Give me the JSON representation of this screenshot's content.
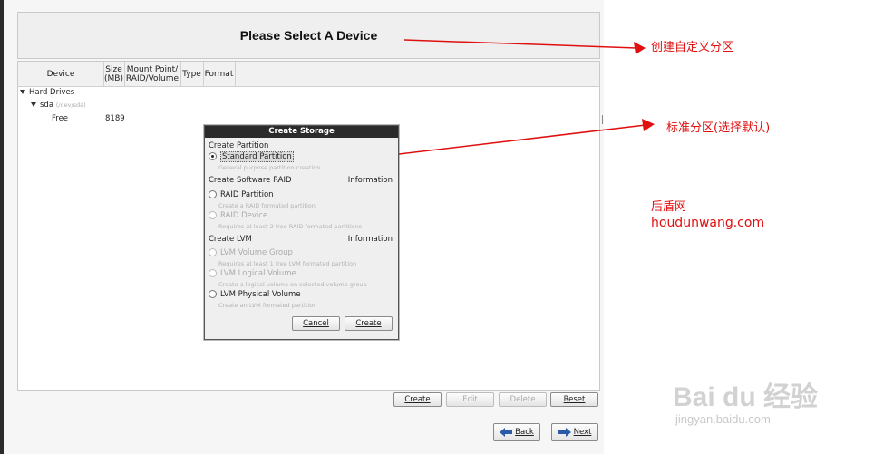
{
  "header": {
    "title": "Please Select A Device"
  },
  "table": {
    "columns": [
      "Device",
      "Size\n(MB)",
      "Mount Point/\nRAID/Volume",
      "Type",
      "Format"
    ],
    "tree": {
      "group": "Hard Drives",
      "disk_name": "sda",
      "disk_path": "(/dev/sda)",
      "free_label": "Free",
      "free_size": "8189"
    }
  },
  "dialog": {
    "title": "Create Storage",
    "partition_section": "Create Partition",
    "standard_partition": "Standard Partition",
    "standard_partition_desc": "General purpose partition creation",
    "raid_section": "Create Software RAID",
    "raid_info": "Information",
    "raid_partition": "RAID Partition",
    "raid_partition_desc": "Create a RAID formated partition",
    "raid_device": "RAID Device",
    "raid_device_desc": "Requires at least 2 free RAID formated partitions",
    "lvm_section": "Create LVM",
    "lvm_info": "Information",
    "lvm_volume_group": "LVM Volume Group",
    "lvm_volume_group_desc": "Requires at least 1 free LVM formated partition",
    "lvm_logical_volume": "LVM Logical Volume",
    "lvm_logical_volume_desc": "Create a logical volume on selected volume group",
    "lvm_physical_volume": "LVM Physical Volume",
    "lvm_physical_volume_desc": "Create an LVM formated partition",
    "cancel": "Cancel",
    "create": "Create"
  },
  "toolbar": {
    "create": "Create",
    "edit": "Edit",
    "delete": "Delete",
    "reset": "Reset"
  },
  "nav": {
    "back": "Back",
    "next": "Next"
  },
  "annotations": {
    "custom_partition": "创建自定义分区",
    "standard_partition_note": "标准分区(选择默认)",
    "site_name": "后盾网",
    "site_url": "houdunwang.com"
  },
  "watermark": {
    "logo": "Bai du 经验",
    "url": "jingyan.baidu.com"
  },
  "colors": {
    "annotation": "#e01010",
    "dialog_title_bg": "#2b2b2b"
  }
}
